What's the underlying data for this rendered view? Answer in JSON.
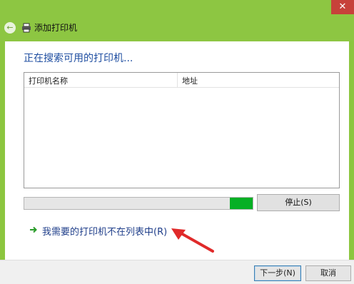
{
  "window": {
    "title": "添加打印机",
    "close_glyph": "✕",
    "back_glyph": "←"
  },
  "main": {
    "heading": "正在搜索可用的打印机...",
    "list_columns": [
      "打印机名称",
      "地址"
    ],
    "progress": 0.1,
    "stop_label": "停止(S)",
    "not_listed_link": "我需要的打印机不在列表中(R)"
  },
  "footer": {
    "next_label": "下一步(N)",
    "cancel_label": "取消"
  },
  "colors": {
    "accent_green": "#8dc642",
    "progress_green": "#06b025",
    "link_blue": "#1f3e8a",
    "annotation_red": "#e02a2a"
  },
  "icons": [
    "back-arrow-icon",
    "printer-icon",
    "close-icon",
    "green-arrow-icon",
    "red-annotation-arrow"
  ]
}
